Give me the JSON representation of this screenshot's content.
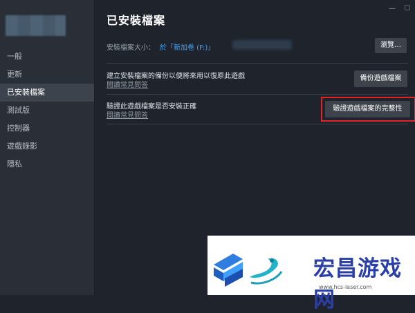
{
  "window": {
    "minimize_glyph": "—",
    "maximize_glyph": "☐"
  },
  "sidebar": {
    "items": [
      {
        "label": "一般"
      },
      {
        "label": "更新"
      },
      {
        "label": "已安裝檔案"
      },
      {
        "label": "測試版"
      },
      {
        "label": "控制器"
      },
      {
        "label": "遊戲錄影"
      },
      {
        "label": "隱私"
      }
    ]
  },
  "main": {
    "title": "已安裝檔案",
    "size_label": "安裝檔案大小：",
    "size_location": "於「新加卷 (F:)」",
    "browse_button": "瀏覽…",
    "backup": {
      "title": "建立安裝檔案的備份以便將來用以復原此遊戲",
      "link": "閱讀常見問答",
      "button": "備份遊戲檔案"
    },
    "verify": {
      "title": "驗證此遊戲檔案是否安裝正確",
      "link": "閱讀常見問答",
      "button": "驗證遊戲檔案的完整性"
    }
  },
  "watermark": {
    "brand": "宏昌游戏网",
    "url": "www.hcs-laser.com"
  },
  "colors": {
    "accent_link": "#3ea6ff",
    "highlight": "#e0242a",
    "brand": "#2b3fa8"
  }
}
